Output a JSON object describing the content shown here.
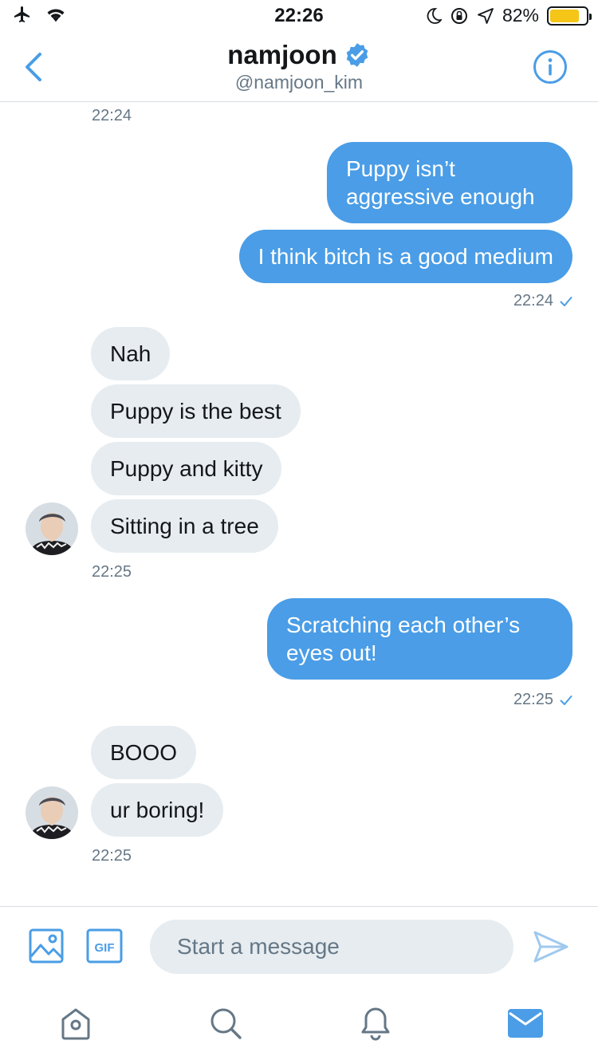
{
  "status_bar": {
    "time": "22:26",
    "battery": "82%",
    "battery_level": 0.82,
    "battery_color": "#f5c518"
  },
  "header": {
    "name": "namjoon",
    "handle": "@namjoon_kim",
    "verified": true,
    "accent": "#4a9de6"
  },
  "conversation": {
    "timestamps": [
      "22:24",
      "22:24",
      "22:25",
      "22:25",
      "22:25"
    ],
    "messages": [
      {
        "from": "me",
        "text": "Puppy isn’t aggressive enough"
      },
      {
        "from": "me",
        "text": "I think bitch is a good medium"
      },
      {
        "from": "them",
        "text": "Nah"
      },
      {
        "from": "them",
        "text": "Puppy is the best"
      },
      {
        "from": "them",
        "text": "Puppy and kitty"
      },
      {
        "from": "them",
        "text": "Sitting in a tree"
      },
      {
        "from": "me",
        "text": "Scratching each other’s eyes out!"
      },
      {
        "from": "them",
        "text": "BOOO"
      },
      {
        "from": "them",
        "text": "ur boring!"
      }
    ]
  },
  "composer": {
    "placeholder": "Start a message",
    "image_icon": "image-icon",
    "gif_label": "GIF",
    "send_icon": "send-icon"
  },
  "tabbar": {
    "items": [
      "home-icon",
      "search-icon",
      "notifications-icon",
      "messages-icon"
    ],
    "active": "messages-icon"
  },
  "colors": {
    "outgoing_bubble": "#4a9de6",
    "incoming_bubble": "#e6ecf0",
    "muted_text": "#657786"
  }
}
